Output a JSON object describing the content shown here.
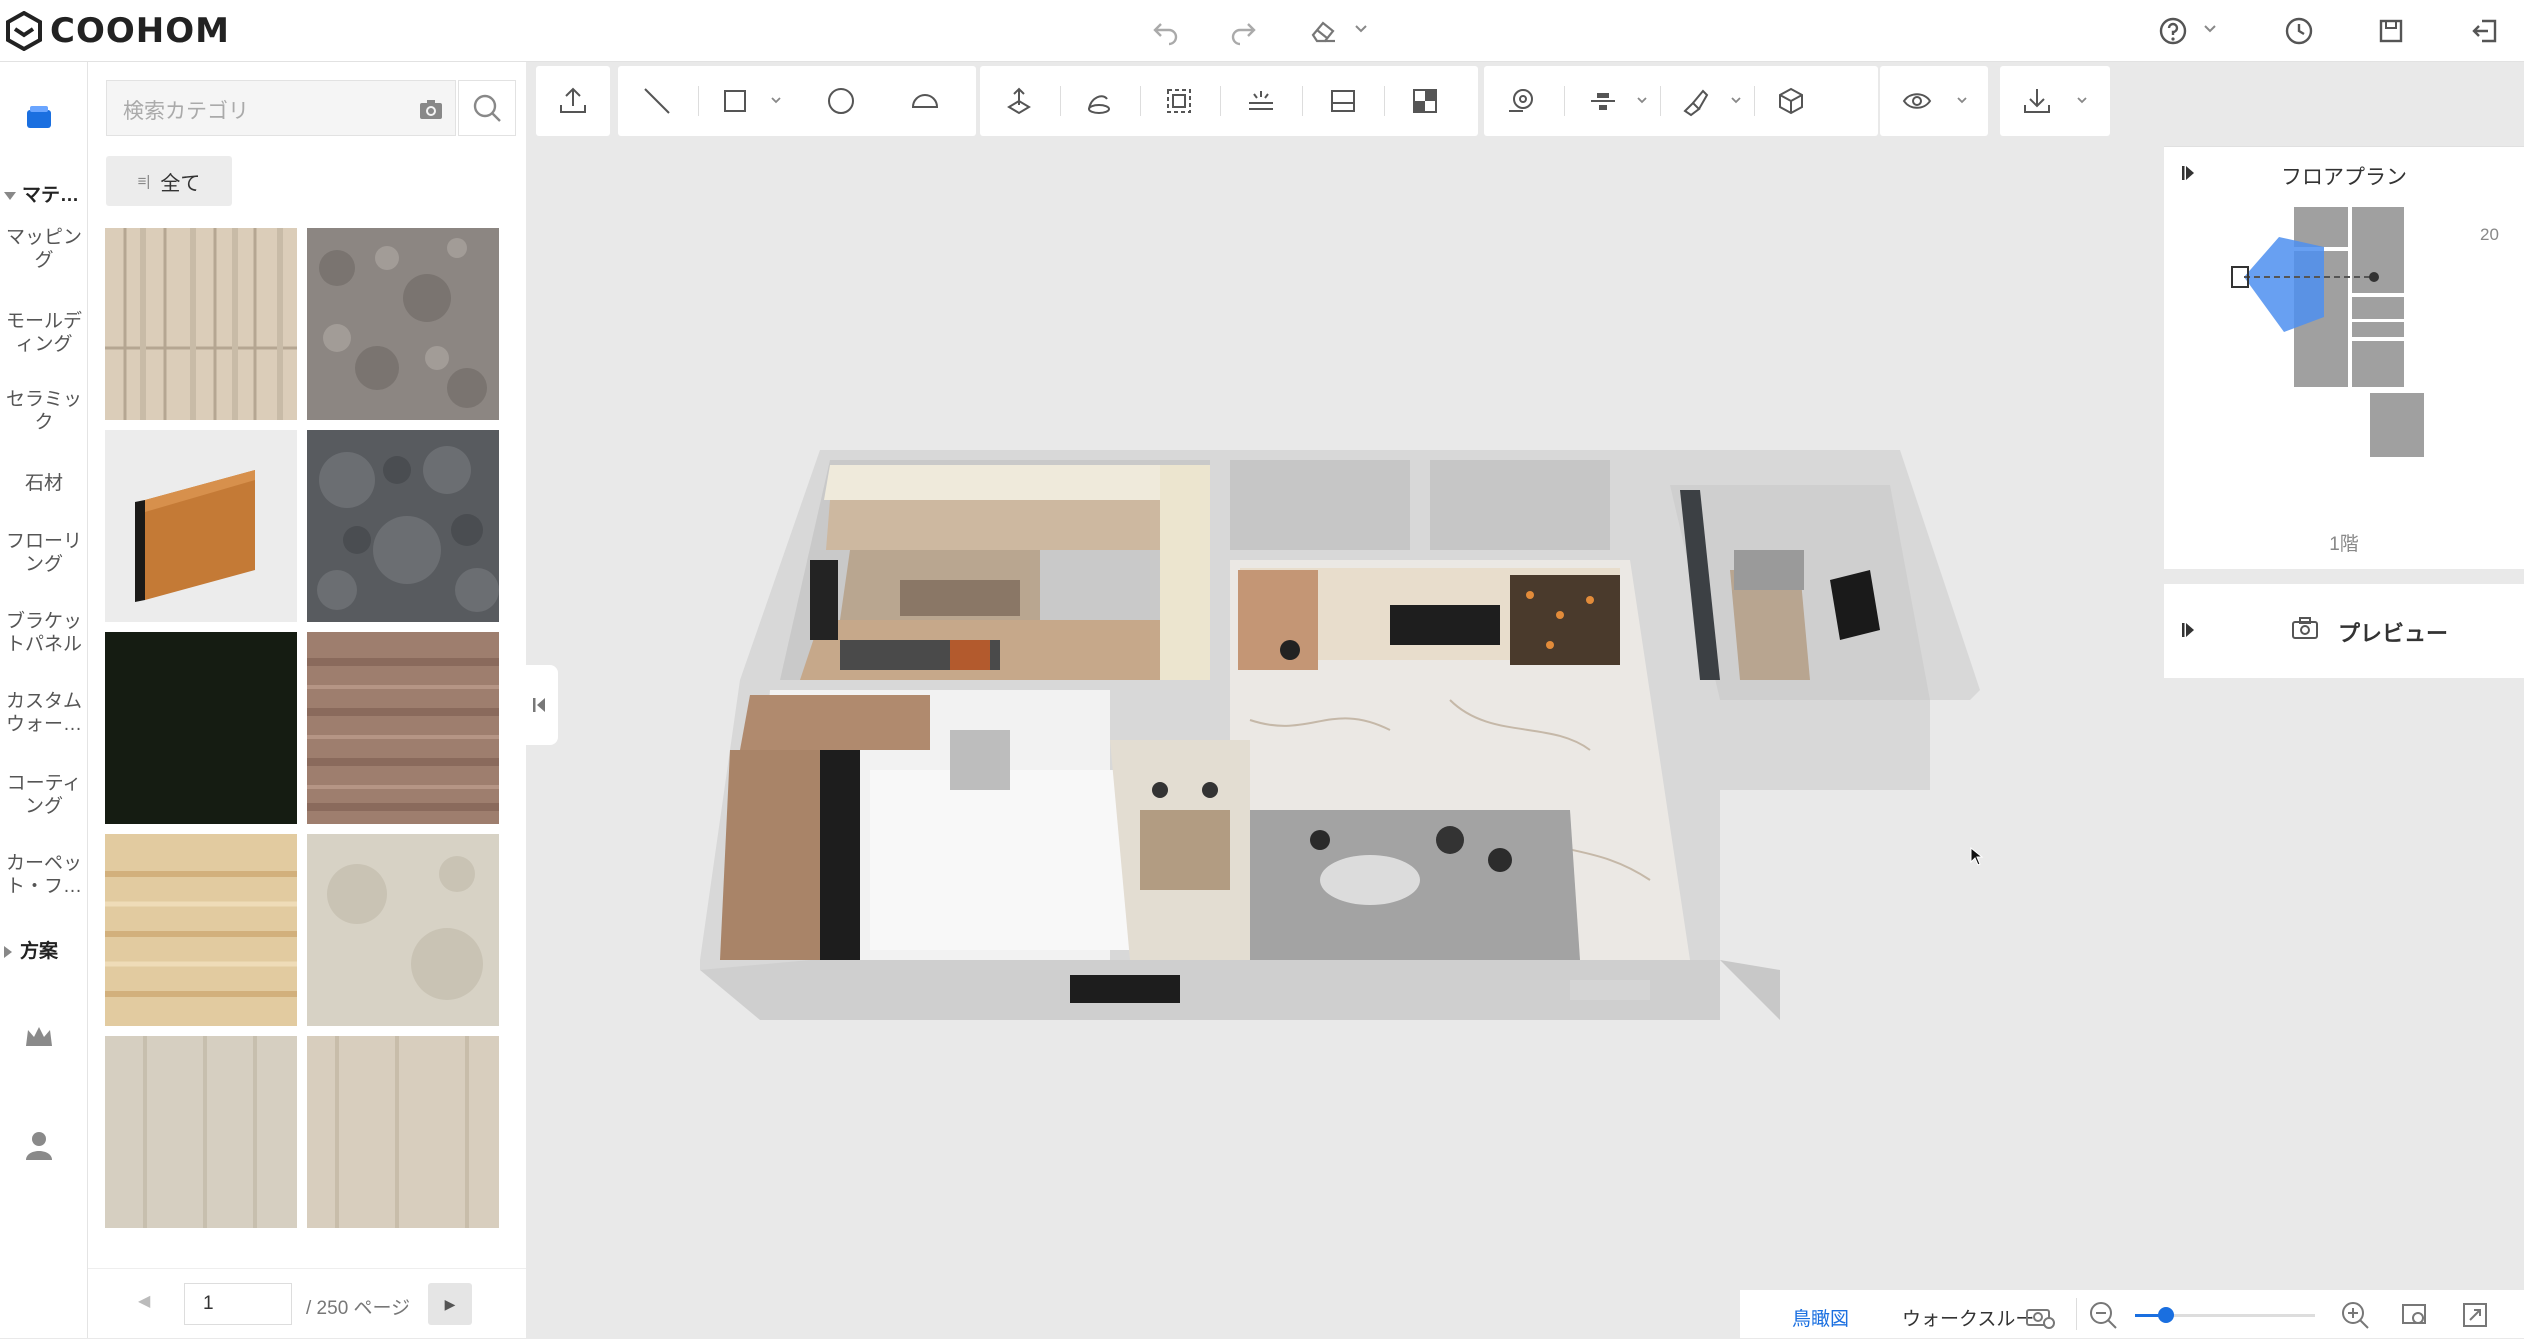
{
  "app": {
    "logo_text": "COOHOM",
    "accent_color": "#1a6fe0"
  },
  "header": {
    "icons": [
      "undo-icon",
      "redo-icon",
      "eraser-icon",
      "help-icon",
      "history-icon",
      "save-icon",
      "exit-icon"
    ]
  },
  "rail": {
    "categories_header": "マテ…",
    "categories": [
      "マッピング",
      "モールディング",
      "セラミック",
      "石材",
      "フローリング",
      "ブラケットパネル",
      "カスタムウォー…",
      "コーティング",
      "カーペット・フ…"
    ],
    "categories_display": [
      [
        "マッピン",
        "グ"
      ],
      [
        "モールデ",
        "ィング"
      ],
      [
        "セラミッ",
        "ク"
      ],
      [
        "石材"
      ],
      [
        "フローリ",
        "ング"
      ],
      [
        "ブラケッ",
        "トパネル"
      ],
      [
        "カスタム",
        "ウォー…"
      ],
      [
        "コーティ",
        "ング"
      ],
      [
        "カーペッ",
        "ト・フ…"
      ]
    ],
    "plan_header": "方案",
    "icons": [
      "material-icon",
      "crown-icon",
      "user-icon"
    ]
  },
  "catalog": {
    "search_placeholder": "検索カテゴリ",
    "all_label": "全て",
    "tiles": [
      {
        "name": "light-wood-texture",
        "color": "#d9cbb7"
      },
      {
        "name": "gray-carpet-texture",
        "color": "#8c8682"
      },
      {
        "name": "wood-molding-sample",
        "color": "#c9803a"
      },
      {
        "name": "dark-slate-texture",
        "color": "#585b5f"
      },
      {
        "name": "black-texture",
        "color": "#151c12"
      },
      {
        "name": "brown-wood-texture",
        "color": "#9e7e6e"
      },
      {
        "name": "yellow-wood-texture",
        "color": "#e2cba0"
      },
      {
        "name": "beige-stone-texture",
        "color": "#d7d2c5"
      },
      {
        "name": "pale-wood-texture-1",
        "color": "#d6cfc1"
      },
      {
        "name": "pale-wood-texture-2",
        "color": "#d8cebe"
      }
    ],
    "pager": {
      "current": "1",
      "total_label": "/ 250 ページ"
    }
  },
  "floor_plan": {
    "title": "フロアプラン",
    "scale_label": "20",
    "level_label": "1階"
  },
  "preview": {
    "title": "プレビュー"
  },
  "bottom": {
    "view_birdseye": "鳥瞰図",
    "view_walkthrough": "ウォークスルー",
    "zoom_level": 0.17
  }
}
